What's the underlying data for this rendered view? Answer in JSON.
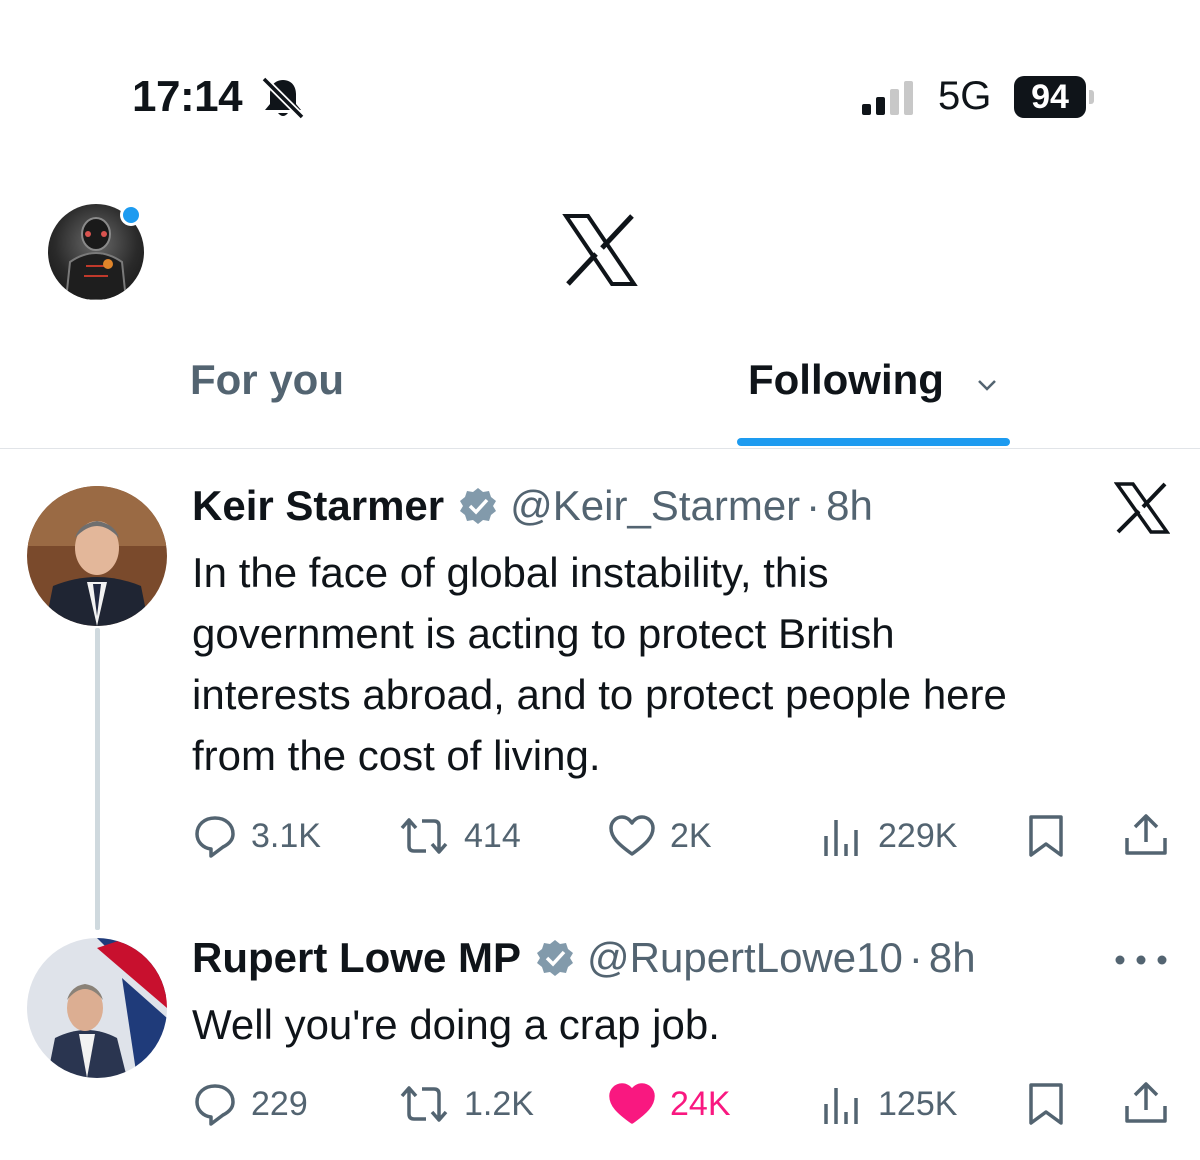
{
  "status_bar": {
    "time": "17:14",
    "network": "5G",
    "battery": "94"
  },
  "tabs": [
    {
      "label": "For you",
      "active": false
    },
    {
      "label": "Following",
      "active": true
    }
  ],
  "tweets": [
    {
      "name": "Keir Starmer",
      "handle": "@Keir_Starmer",
      "time": "8h",
      "text_lines": [
        "In the face of global instability, this",
        "government is acting to protect British",
        "interests abroad, and to protect people here",
        "from the cost of living."
      ],
      "replies": "3.1K",
      "reposts": "414",
      "likes": "2K",
      "views": "229K",
      "liked": false
    },
    {
      "name": "Rupert Lowe MP",
      "handle": "@RupertLowe10",
      "time": "8h",
      "text_lines": [
        "Well you're doing a crap job."
      ],
      "replies": "229",
      "reposts": "1.2K",
      "likes": "24K",
      "views": "125K",
      "liked": true
    }
  ],
  "colors": {
    "accent": "#1d9bf0",
    "like": "#f91880",
    "secondary_text": "#536471",
    "text": "#0f1419"
  },
  "icons": [
    "bell-muted-icon",
    "signal-icon",
    "x-logo-icon",
    "verified-badge-icon",
    "reply-icon",
    "repost-icon",
    "like-icon",
    "views-icon",
    "bookmark-icon",
    "share-icon",
    "more-icon"
  ]
}
